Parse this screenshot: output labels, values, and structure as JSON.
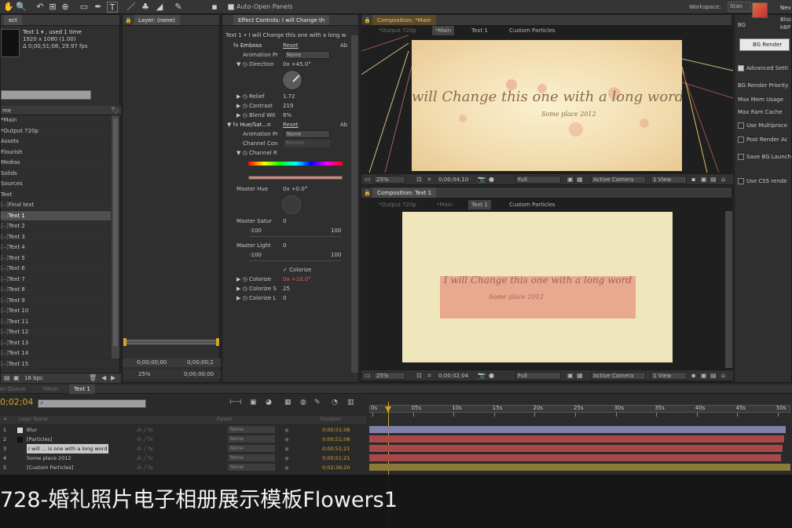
{
  "toolbar": {
    "auto_open_label": "Auto-Open Panels",
    "workspace_label": "Workspace:",
    "workspace_value": "Stan",
    "icons": [
      "hand-tool-icon",
      "zoom-tool-icon",
      "rotate-tool-icon",
      "camera-tool-icon",
      "pan-behind-icon",
      "rectangle-tool-icon",
      "pen-tool-icon",
      "text-tool-icon",
      "brush-tool-icon",
      "clone-stamp-icon",
      "eraser-icon",
      "roto-brush-icon",
      "puppet-pin-icon"
    ]
  },
  "project": {
    "header_title": "Text 1 ▾ , used 1 time",
    "header_size": "1920 x 1080 (1.00)",
    "header_duration": "Δ 0;00;51;08, 29.97 fps",
    "tab_label": "ect",
    "col_name": "me",
    "items": [
      "*Main",
      "*Output 720p",
      "Assets",
      "Flourish",
      "Medias",
      "Solids",
      "Sources",
      "Text",
      "Final text",
      "Text 1",
      "Text 2",
      "Text 3",
      "Text 4",
      "Text 5",
      "Text 6",
      "Text 7",
      "Text 8",
      "Text 9",
      "Text 10",
      "Text 11",
      "Text 12",
      "Text 13",
      "Text 14",
      "Text 15"
    ],
    "selected_index": 9,
    "bpc_label": "16 bpc"
  },
  "layer_panel": {
    "tab_label": "Layer: (none)",
    "timecode": "0;00;00;00",
    "timecode2": "0;00;00;2",
    "zoom": "25%",
    "timecode3": "0;00;00;00"
  },
  "effect_controls": {
    "tab_label": "Effect Controls: I will Change th",
    "breadcrumb": "Text 1 • I will Change this one with a long w",
    "emboss": {
      "name": "Emboss",
      "reset": "Reset",
      "about": "Ab",
      "animation_preset_label": "Animation Pr",
      "animation_preset_value": "None",
      "direction_label": "Direction",
      "direction_value": "0x +45.0°",
      "relief_label": "Relief",
      "relief_value": "1.72",
      "contrast_label": "Contrast",
      "contrast_value": "219",
      "blend_label": "Blend Wit",
      "blend_value": "8%"
    },
    "hue_sat": {
      "name": "Hue/Sat...n",
      "reset": "Reset",
      "about": "Ab",
      "animation_preset_label": "Animation Pr",
      "animation_preset_value": "None",
      "channel_control_label": "Channel Con",
      "channel_control_value": "Master",
      "channel_range_label": "Channel R",
      "master_hue_label": "Master Hue",
      "master_hue_value": "0x +0.0°",
      "master_sat_label": "Master Satur",
      "master_sat_value": "0",
      "master_sat_min": "-100",
      "master_sat_max": "100",
      "master_light_label": "Master Light",
      "master_light_value": "0",
      "master_light_min": "-100",
      "master_light_max": "100",
      "colorize_label": "Colorize",
      "colorize_hue_label": "Colorize",
      "colorize_hue_value": "0x +10.0°",
      "colorize_sat_label": "Colorize S",
      "colorize_sat_value": "25",
      "colorize_light_label": "Colorize L",
      "colorize_light_value": "0"
    }
  },
  "comp_top": {
    "tab_label": "Composition: *Main",
    "breadcrumbs": [
      "*Output 720p",
      "*Main",
      "Text 1",
      "Custom Particles"
    ],
    "script_text": "will Change this one with a long word",
    "sub_text": "Some place 2012",
    "zoom": "25%",
    "timecode": "0;00;04;10",
    "resolution": "Full",
    "camera": "Active Camera",
    "view": "1 View"
  },
  "comp_bottom": {
    "tab_label": "Composition: Text 1",
    "breadcrumbs": [
      "*Output 720p",
      "*Main",
      "Text 1",
      "Custom Particles"
    ],
    "script_text": "I will Change this one with a long word",
    "sub_text": "Some place 2012",
    "zoom": "25%",
    "timecode": "0;00;02;04",
    "resolution": "Full",
    "camera": "Active Camera",
    "view": "1 View"
  },
  "right_panel": {
    "render_name": "Nev",
    "render_sub1": "Bloc",
    "render_sub2": "kBP",
    "bg_label": "BG",
    "bg_render_button": "BG Render",
    "advanced_label": "Advanced Setti",
    "options": [
      "BG Render Priority",
      "Max Mem Usage",
      "Max Ram Cache"
    ],
    "checkboxes": [
      "Use Multiproce",
      "Post Render Ac",
      "Save BG Launch",
      "Use CS5 rende"
    ]
  },
  "timeline": {
    "tabs": [
      "er Queue",
      "*Main",
      "Text 1"
    ],
    "active_tab": 2,
    "timecode": "0;02;04",
    "search_placeholder": "",
    "col_layer_name": "Layer Name",
    "col_parent": "Parent",
    "col_duration": "Duration",
    "layers": [
      {
        "num": "1",
        "name": "Blur",
        "parent": "None",
        "duration": "0;00;51;08",
        "color": "#8080a8"
      },
      {
        "num": "2",
        "name": "[Particles]",
        "parent": "None",
        "duration": "0;00;51;08",
        "color": "#a84848"
      },
      {
        "num": "3",
        "name": "I will ... is one with a long word",
        "parent": "None",
        "duration": "0;00;51;21",
        "color": "#a84848"
      },
      {
        "num": "4",
        "name": "Some place 2012",
        "parent": "None",
        "duration": "0;00;51;21",
        "color": "#a84848"
      },
      {
        "num": "5",
        "name": "[Custom Particles]",
        "parent": "None",
        "duration": "0;02;36;20",
        "color": "#8a7a3a"
      }
    ],
    "ruler": [
      "0s",
      "05s",
      "10s",
      "15s",
      "20s",
      "25s",
      "30s",
      "35s",
      "40s",
      "45s",
      "50s"
    ]
  },
  "caption": {
    "text": "728-婚礼照片电子相册展示模板Flowers1"
  }
}
